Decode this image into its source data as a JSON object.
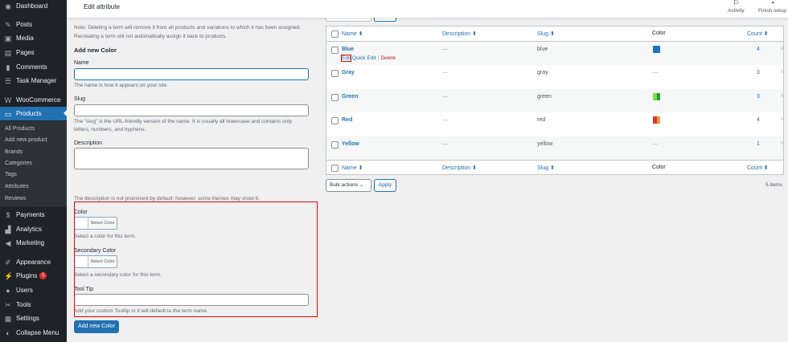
{
  "sidebar": {
    "items": [
      {
        "label": "Dashboard",
        "icon": "dashboard-icon",
        "glyph": "◉"
      },
      {
        "label": "Posts",
        "icon": "pin-icon",
        "glyph": "✎"
      },
      {
        "label": "Media",
        "icon": "media-icon",
        "glyph": "▣"
      },
      {
        "label": "Pages",
        "icon": "pages-icon",
        "glyph": "▤"
      },
      {
        "label": "Comments",
        "icon": "comment-icon",
        "glyph": "▮"
      },
      {
        "label": "Task Manager",
        "icon": "list-icon",
        "glyph": "☰"
      },
      {
        "label": "WooCommerce",
        "icon": "woo-icon",
        "glyph": "W"
      },
      {
        "label": "Products",
        "icon": "archive-icon",
        "glyph": "▭"
      },
      {
        "label": "Payments",
        "icon": "dollar-icon",
        "glyph": "$"
      },
      {
        "label": "Analytics",
        "icon": "bar-chart-icon",
        "glyph": "▟"
      },
      {
        "label": "Marketing",
        "icon": "megaphone-icon",
        "glyph": "◀"
      },
      {
        "label": "Appearance",
        "icon": "brush-icon",
        "glyph": "✐"
      },
      {
        "label": "Plugins",
        "icon": "plugin-icon",
        "glyph": "⚡",
        "badge": "1"
      },
      {
        "label": "Users",
        "icon": "user-icon",
        "glyph": "●"
      },
      {
        "label": "Tools",
        "icon": "wrench-icon",
        "glyph": "✂"
      },
      {
        "label": "Settings",
        "icon": "settings-icon",
        "glyph": "▦"
      },
      {
        "label": "Collapse Menu",
        "icon": "collapse-icon",
        "glyph": "◐"
      }
    ],
    "submenu": [
      "All Products",
      "Add new product",
      "Brands",
      "Categories",
      "Tags",
      "Attributes",
      "Reviews"
    ]
  },
  "topbar": {
    "title": "Edit attribute",
    "activity": "Activity",
    "finish_setup": "Finish setup"
  },
  "form": {
    "note": "Note: Deleting a term will remove it from all products and variations to which it has been assigned.",
    "note2": "Recreating a term will not automatically assign it back to products.",
    "heading": "Add new Color",
    "name_label": "Name",
    "name_help": "The name is how it appears on your site.",
    "slug_label": "Slug",
    "slug_help": "The “slug” is the URL-friendly version of the name. It is usually all lowercase and contains only",
    "slug_help2": "letters, numbers, and hyphens.",
    "desc_label": "Description",
    "desc_help": "The description is not prominent by default; however, some themes may show it.",
    "color_label": "Color",
    "select_color": "Select Color",
    "color_help": "Select a color for this term.",
    "sec_label": "Secondary Color",
    "sec_help": "Select a secondary color for this term.",
    "tooltip_label": "Tool Tip",
    "tooltip_help": "Add your custom Tooltip or it will default to the term name.",
    "submit": "Add new Color"
  },
  "table": {
    "headers": {
      "name": "Name ⬍",
      "description": "Description ⬍",
      "slug": "Slug ⬍",
      "color": "Color",
      "count": "Count ⬍"
    },
    "rows": [
      {
        "name": "Blue",
        "description": "—",
        "slug": "blue",
        "colors": [
          "#1e73be"
        ],
        "count": "4"
      },
      {
        "name": "Gray",
        "description": "—",
        "slug": "gray",
        "color_text": "—",
        "colors": [],
        "count": "3"
      },
      {
        "name": "Green",
        "description": "—",
        "slug": "green",
        "colors": [
          "#81d742",
          "#1e9e3a"
        ],
        "count": "3"
      },
      {
        "name": "Red",
        "description": "—",
        "slug": "red",
        "colors": [
          "#dd3333",
          "#e89a3c"
        ],
        "count": "4"
      },
      {
        "name": "Yellow",
        "description": "—",
        "slug": "yellow",
        "color_text": "—",
        "colors": [],
        "count": "1"
      }
    ],
    "row_actions": {
      "edit": "Edit",
      "quick_edit": "Quick Edit",
      "delete": "Delete",
      "sep": "|"
    },
    "bulk_actions": "Bulk actions",
    "apply": "Apply",
    "items": "5 items"
  }
}
